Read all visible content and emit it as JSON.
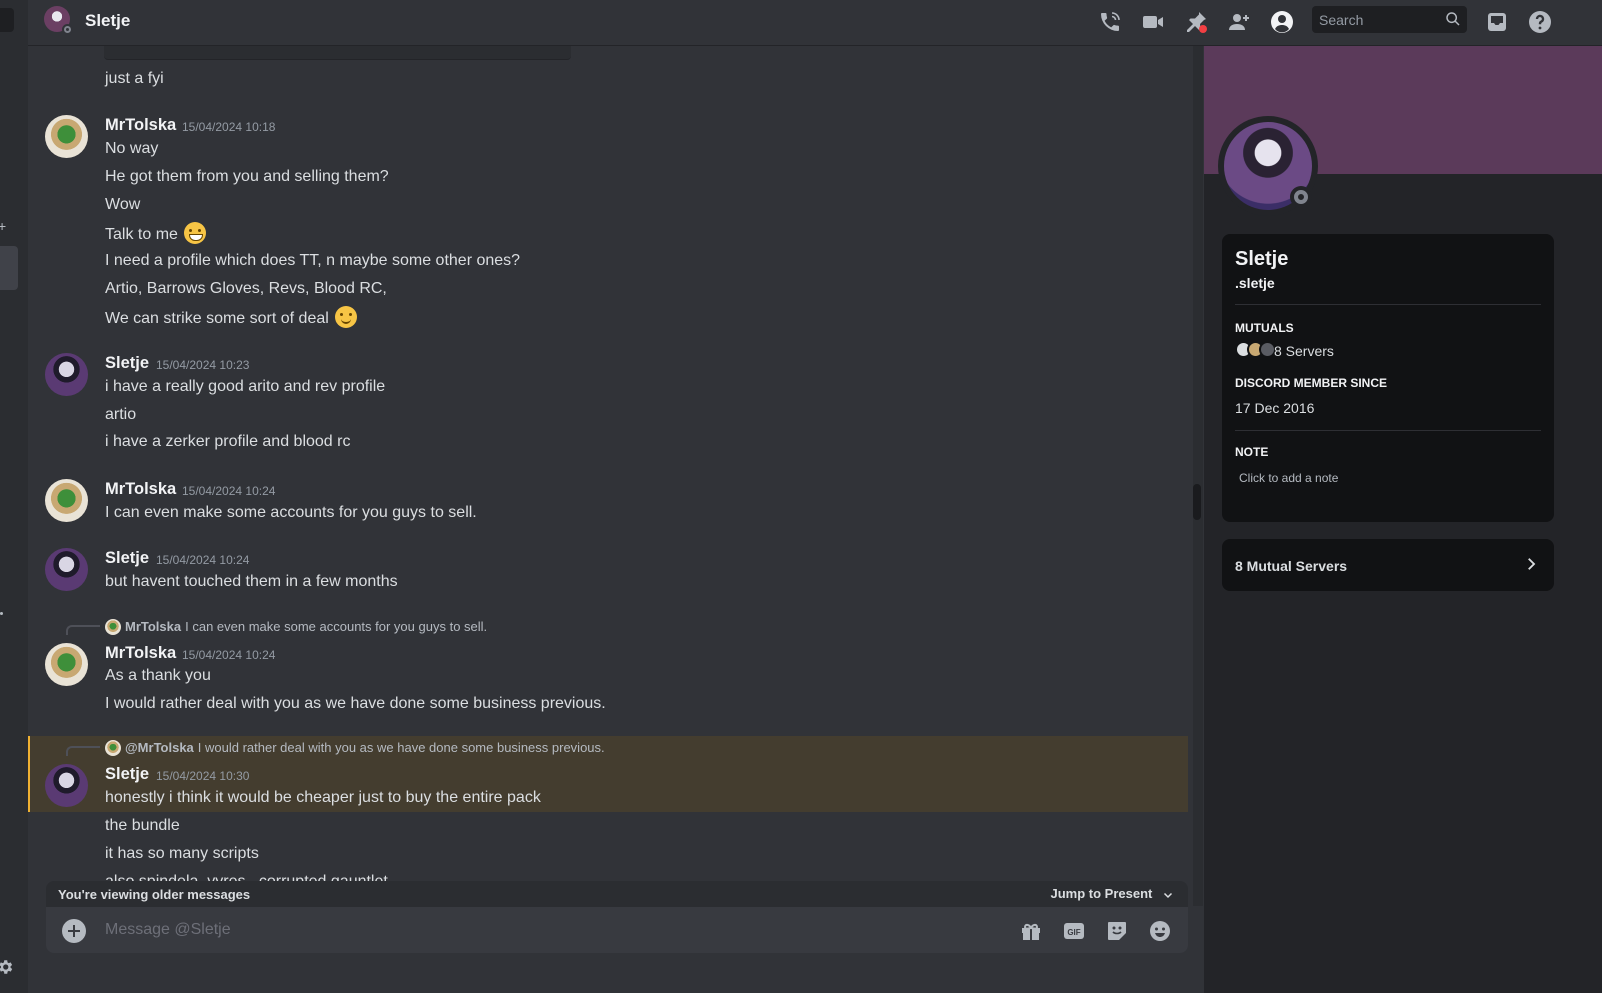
{
  "header": {
    "title": "Sletje",
    "search_placeholder": "Search"
  },
  "chat": {
    "embed_tail_text": "just a fyi",
    "messages": [
      {
        "author": "MrTolska",
        "timestamp": "15/04/2024 10:18",
        "lines": [
          "No way",
          "He got them from you and selling them?",
          "Wow",
          "Talk to me",
          "I need a profile which does TT, n maybe some other ones?",
          "Artio, Barrows Gloves, Revs, Blood RC,",
          "We can strike some sort of deal"
        ]
      },
      {
        "author": "Sletje",
        "timestamp": "15/04/2024 10:23",
        "lines": [
          "i have a really good arito and rev profile",
          "artio",
          "i have a zerker profile and blood rc"
        ]
      },
      {
        "author": "MrTolska",
        "timestamp": "15/04/2024 10:24",
        "lines": [
          "I can even make some accounts for you guys to sell."
        ]
      },
      {
        "author": "Sletje",
        "timestamp": "15/04/2024 10:24",
        "lines": [
          "but havent touched them in a few months"
        ]
      },
      {
        "author": "MrTolska",
        "timestamp": "15/04/2024 10:24",
        "reply_to": {
          "name": "MrTolska",
          "text": "I can even make some accounts for you guys to sell."
        },
        "lines": [
          "As a thank you",
          "I would rather deal with you as we have done some business previous."
        ]
      },
      {
        "author": "Sletje",
        "timestamp": "15/04/2024 10:30",
        "reply_to": {
          "name": "@MrTolska",
          "text": "I would rather deal with you as we have done some business previous."
        },
        "lines": [
          "honestly i think it would be cheaper just to buy the entire pack",
          "the bundle",
          "it has so many scripts",
          "also spindela, vyres , corrupted gauntlet"
        ]
      }
    ]
  },
  "older_bar": {
    "label": "You're viewing older messages",
    "jump": "Jump to Present"
  },
  "composer": {
    "placeholder": "Message @Sletje"
  },
  "profile": {
    "display_name": "Sletje",
    "username": ".sletje",
    "mutuals_title": "MUTUALS",
    "mutuals_value": "8 Servers",
    "member_since_title": "DISCORD MEMBER SINCE",
    "member_since_value": "17 Dec 2016",
    "note_title": "NOTE",
    "note_placeholder": "Click to add a note",
    "mutual_servers_button": "8 Mutual Servers"
  },
  "colors": {
    "banner": "#5b3a5a",
    "highlight": "#443d2f",
    "highlight_border": "#f0b132"
  }
}
